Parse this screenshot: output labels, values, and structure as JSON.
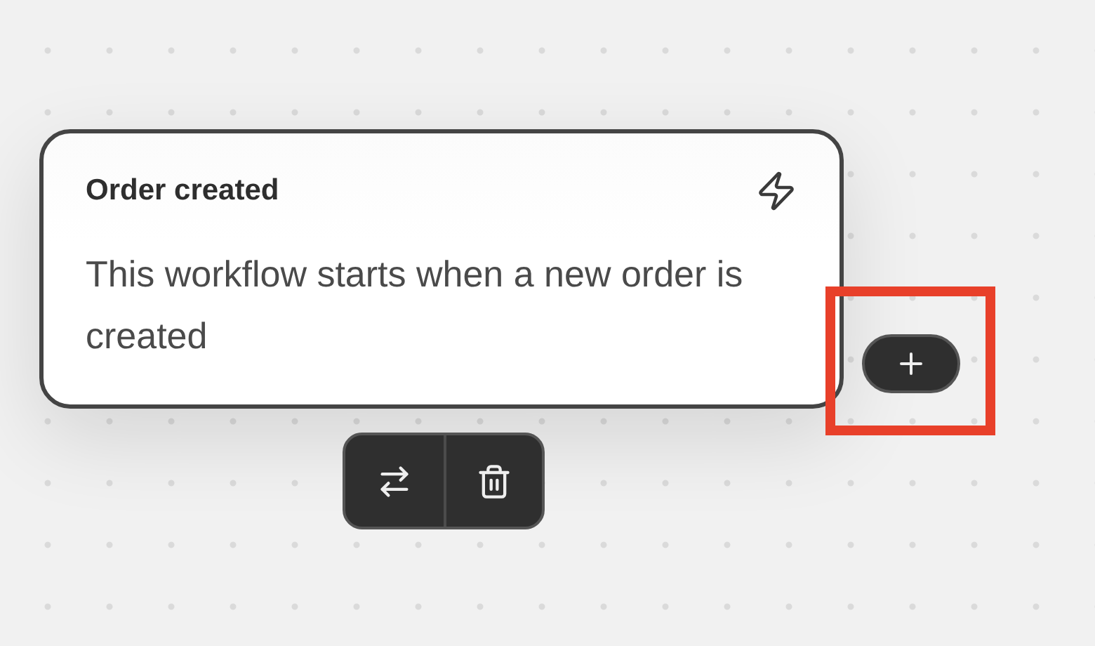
{
  "node": {
    "title": "Order created",
    "description": "This workflow starts when a new order is created"
  }
}
